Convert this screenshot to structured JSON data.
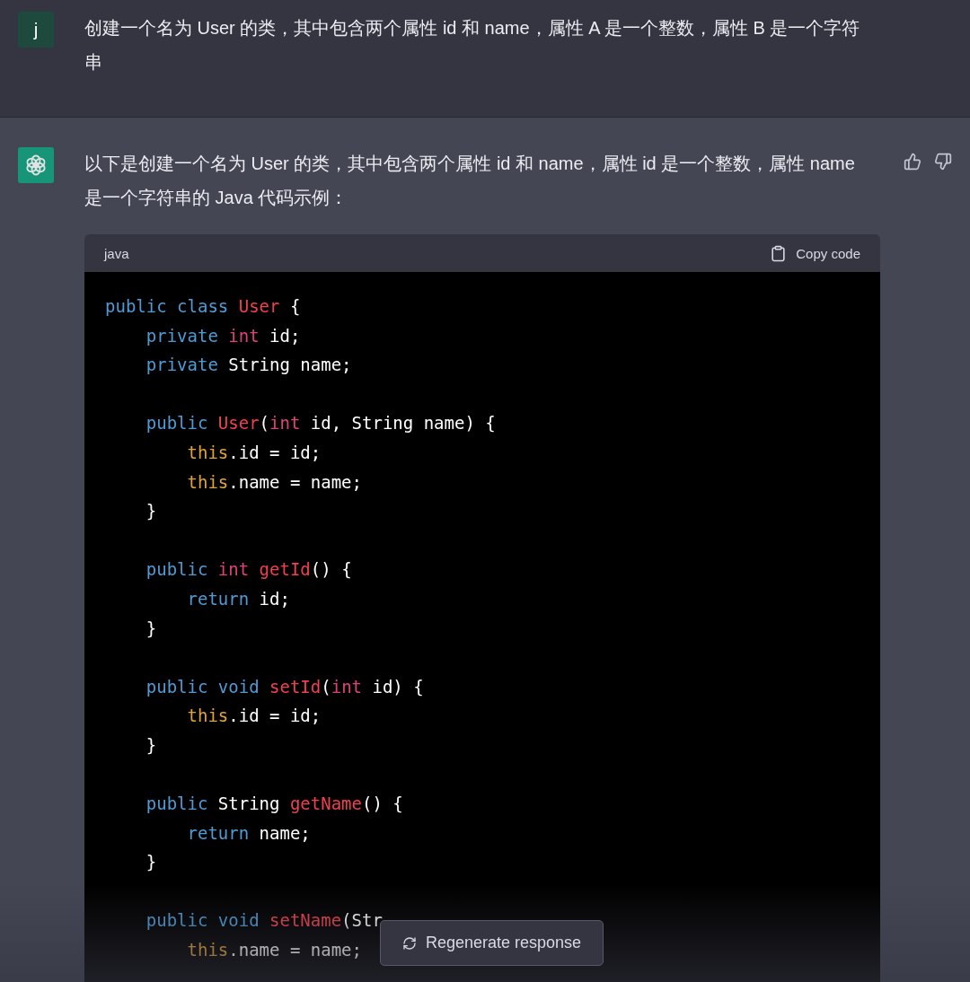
{
  "messages": [
    {
      "kind": "user",
      "avatar": "j",
      "text": "创建一个名为 User 的类，其中包含两个属性 id 和 name，属性 A 是一个整数，属性 B 是一个字符串"
    },
    {
      "kind": "assistant",
      "text": "以下是创建一个名为 User 的类，其中包含两个属性 id 和 name，属性 id 是一个整数，属性 name 是一个字符串的 Java 代码示例：",
      "code_block": {
        "language": "java",
        "copy_label": "Copy code",
        "lines": [
          {
            "kind": "code",
            "tokens": [
              {
                "t": "public class ",
                "kind": "kw"
              },
              {
                "t": "User",
                "kind": "fn"
              },
              {
                "t": " {",
                "kind": "plain"
              }
            ]
          },
          {
            "kind": "code",
            "tokens": [
              {
                "t": "    private ",
                "kind": "kw"
              },
              {
                "t": "int",
                "kind": "type"
              },
              {
                "t": " id;",
                "kind": "plain"
              }
            ]
          },
          {
            "kind": "code",
            "tokens": [
              {
                "t": "    private",
                "kind": "kw"
              },
              {
                "t": " String name;",
                "kind": "plain"
              }
            ]
          },
          {
            "kind": "blank"
          },
          {
            "kind": "code",
            "tokens": [
              {
                "t": "    public ",
                "kind": "kw"
              },
              {
                "t": "User",
                "kind": "fn"
              },
              {
                "t": "(",
                "kind": "plain"
              },
              {
                "t": "int",
                "kind": "type"
              },
              {
                "t": " id, String name) {",
                "kind": "plain"
              }
            ]
          },
          {
            "kind": "code",
            "tokens": [
              {
                "t": "        this",
                "kind": "this"
              },
              {
                "t": ".id = id;",
                "kind": "plain"
              }
            ]
          },
          {
            "kind": "code",
            "tokens": [
              {
                "t": "        this",
                "kind": "this"
              },
              {
                "t": ".name = name;",
                "kind": "plain"
              }
            ]
          },
          {
            "kind": "code",
            "tokens": [
              {
                "t": "    }",
                "kind": "plain"
              }
            ]
          },
          {
            "kind": "blank"
          },
          {
            "kind": "code",
            "tokens": [
              {
                "t": "    public ",
                "kind": "kw"
              },
              {
                "t": "int ",
                "kind": "type"
              },
              {
                "t": "getId",
                "kind": "fn"
              },
              {
                "t": "() {",
                "kind": "plain"
              }
            ]
          },
          {
            "kind": "code",
            "tokens": [
              {
                "t": "        return",
                "kind": "kw"
              },
              {
                "t": " id;",
                "kind": "plain"
              }
            ]
          },
          {
            "kind": "code",
            "tokens": [
              {
                "t": "    }",
                "kind": "plain"
              }
            ]
          },
          {
            "kind": "blank"
          },
          {
            "kind": "code",
            "tokens": [
              {
                "t": "    public void ",
                "kind": "kw"
              },
              {
                "t": "setId",
                "kind": "fn"
              },
              {
                "t": "(",
                "kind": "plain"
              },
              {
                "t": "int",
                "kind": "type"
              },
              {
                "t": " id) {",
                "kind": "plain"
              }
            ]
          },
          {
            "kind": "code",
            "tokens": [
              {
                "t": "        this",
                "kind": "this"
              },
              {
                "t": ".id = id;",
                "kind": "plain"
              }
            ]
          },
          {
            "kind": "code",
            "tokens": [
              {
                "t": "    }",
                "kind": "plain"
              }
            ]
          },
          {
            "kind": "blank"
          },
          {
            "kind": "code",
            "tokens": [
              {
                "t": "    public",
                "kind": "kw"
              },
              {
                "t": " String ",
                "kind": "plain"
              },
              {
                "t": "getName",
                "kind": "fn"
              },
              {
                "t": "() {",
                "kind": "plain"
              }
            ]
          },
          {
            "kind": "code",
            "tokens": [
              {
                "t": "        return",
                "kind": "kw"
              },
              {
                "t": " name;",
                "kind": "plain"
              }
            ]
          },
          {
            "kind": "code",
            "tokens": [
              {
                "t": "    }",
                "kind": "plain"
              }
            ]
          },
          {
            "kind": "blank"
          },
          {
            "kind": "code",
            "tokens": [
              {
                "t": "    public void ",
                "kind": "kw"
              },
              {
                "t": "setName",
                "kind": "fn"
              },
              {
                "t": "(Str",
                "kind": "plain"
              }
            ]
          },
          {
            "kind": "code",
            "tokens": [
              {
                "t": "        this",
                "kind": "this"
              },
              {
                "t": ".name = name;",
                "kind": "plain"
              }
            ]
          }
        ]
      }
    }
  ],
  "regenerate_button": {
    "label": "Regenerate response"
  }
}
